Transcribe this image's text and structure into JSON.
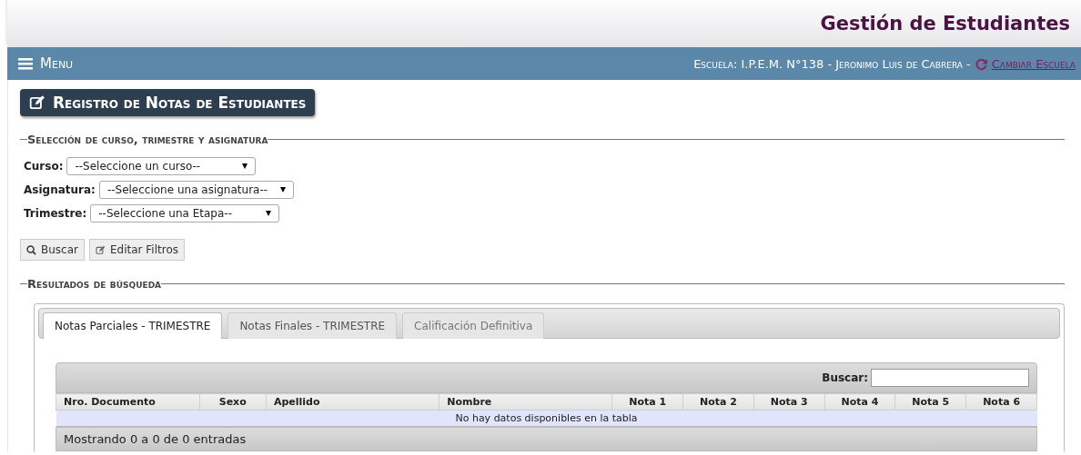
{
  "header": {
    "title": "Gestión de Estudiantes"
  },
  "navbar": {
    "menu": "Menu",
    "school": "Escuela: I.P.E.M. N°138 - Jeronimo Luis de Cabrera -",
    "change_link": "Cambiar Escuela"
  },
  "page_title": "Registro de Notas de Estudiantes",
  "filters": {
    "legend": "Selección de curso, trimestre y asignatura",
    "fields": [
      {
        "label": "Curso:",
        "value": "--Seleccione un curso--"
      },
      {
        "label": "Asignatura:",
        "value": "--Seleccione una asignatura--"
      },
      {
        "label": "Trimestre:",
        "value": "--Seleccione una Etapa--"
      }
    ],
    "buttons": [
      {
        "label": "Buscar",
        "kind": "search"
      },
      {
        "label": "Editar Filtros",
        "kind": "edit"
      }
    ]
  },
  "results": {
    "legend": "Resultados de búsqueda",
    "tabs": [
      {
        "label": "Notas Parciales - TRIMESTRE",
        "selected": true
      },
      {
        "label": "Notas Finales - TRIMESTRE",
        "selected": false
      },
      {
        "label": "Calificación Definitiva",
        "selected": false
      }
    ],
    "search_label": "Buscar:",
    "table": {
      "columns": [
        "Nro. Documento",
        "Sexo",
        "Apellido",
        "Nombre",
        "Nota 1",
        "Nota 2",
        "Nota 3",
        "Nota 4",
        "Nota 5",
        "Nota 6"
      ],
      "empty_message": "No hay datos disponibles en la tabla"
    },
    "info": "Mostrando 0 a 0 de 0 entradas"
  }
}
